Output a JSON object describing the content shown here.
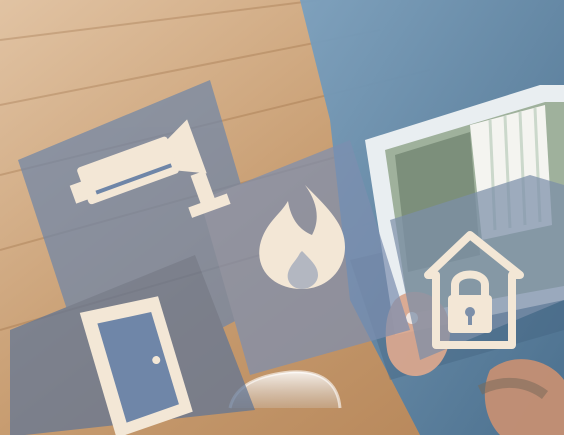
{
  "scene": {
    "description_label": "",
    "icons": [
      {
        "name": "security-camera-icon"
      },
      {
        "name": "fire-icon"
      },
      {
        "name": "door-icon"
      },
      {
        "name": "house-lock-icon"
      }
    ],
    "colors": {
      "floor_wood": "#c9a27a",
      "denim": "#5f87a8",
      "tile_overlay": "#6f86a8",
      "icon_fill": "#f3e7d6",
      "tablet_frame": "#e9eef1"
    }
  }
}
